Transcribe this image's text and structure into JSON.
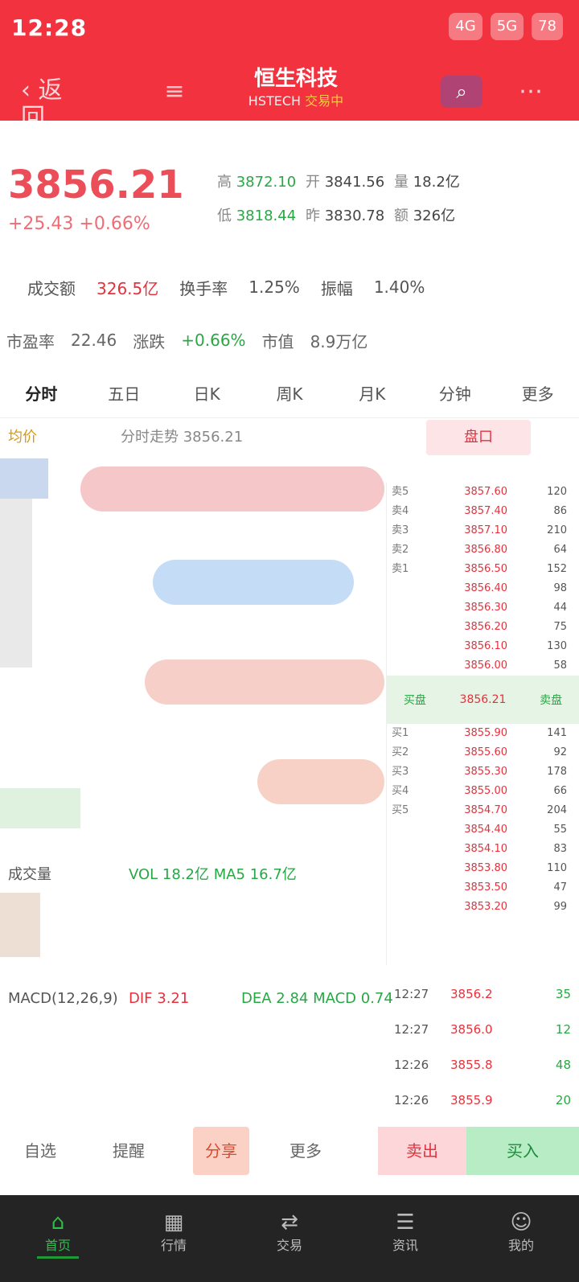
{
  "status_bar": {
    "time": "12:28",
    "indicators": [
      "4G",
      "5G",
      "78"
    ]
  },
  "header": {
    "back_label": "‹ 返回",
    "stock_name": "恒生科技",
    "stock_code": "HSTECH",
    "stock_status": "交易中",
    "menu_icon": "menu-icon",
    "search_icon": "search-icon",
    "more_icon": "more-icon"
  },
  "quote": {
    "price": "3856.21",
    "change": "+25.43 +0.66%",
    "rows": [
      [
        {
          "label": "高",
          "value": "3872.10",
          "tone": "green"
        },
        {
          "label": "开",
          "value": "3841.56",
          "tone": "dark"
        },
        {
          "label": "量",
          "value": "18.2亿",
          "tone": "dark"
        }
      ],
      [
        {
          "label": "低",
          "value": "3818.44",
          "tone": "green"
        },
        {
          "label": "昨",
          "value": "3830.78",
          "tone": "dark"
        },
        {
          "label": "额",
          "value": "326亿",
          "tone": "dark"
        }
      ]
    ]
  },
  "info_row1": [
    "成交额",
    "326.5亿",
    "换手率",
    "1.25%",
    "振幅",
    "1.40%"
  ],
  "info_row2": [
    "市盈率",
    "22.46",
    "涨跌",
    "+0.66%",
    "市值",
    "8.9万亿"
  ],
  "tabs": [
    "分时",
    "五日",
    "日K",
    "周K",
    "月K",
    "分钟",
    "更多"
  ],
  "chart_header": {
    "left": "均价",
    "mid": "分时走势 3856.21",
    "right": "盘口"
  },
  "orderbook": {
    "asks": [
      {
        "label": "卖5",
        "price": "3857.60",
        "vol": "120"
      },
      {
        "label": "卖4",
        "price": "3857.40",
        "vol": "86"
      },
      {
        "label": "卖3",
        "price": "3857.10",
        "vol": "210"
      },
      {
        "label": "卖2",
        "price": "3856.80",
        "vol": "64"
      },
      {
        "label": "卖1",
        "price": "3856.50",
        "vol": "152"
      },
      {
        "label": "",
        "price": "3856.40",
        "vol": "98"
      },
      {
        "label": "",
        "price": "3856.30",
        "vol": "44"
      },
      {
        "label": "",
        "price": "3856.20",
        "vol": "75"
      },
      {
        "label": "",
        "price": "3856.10",
        "vol": "130"
      },
      {
        "label": "",
        "price": "3856.00",
        "vol": "58"
      }
    ],
    "sep_left": "买盘",
    "sep_mid": "3856.21",
    "sep_right": "卖盘",
    "bids": [
      {
        "label": "买1",
        "price": "3855.90",
        "vol": "141"
      },
      {
        "label": "买2",
        "price": "3855.60",
        "vol": "92"
      },
      {
        "label": "买3",
        "price": "3855.30",
        "vol": "178"
      },
      {
        "label": "买4",
        "price": "3855.00",
        "vol": "66"
      },
      {
        "label": "买5",
        "price": "3854.70",
        "vol": "204"
      },
      {
        "label": "",
        "price": "3854.40",
        "vol": "55"
      },
      {
        "label": "",
        "price": "3854.10",
        "vol": "83"
      },
      {
        "label": "",
        "price": "3853.80",
        "vol": "110"
      },
      {
        "label": "",
        "price": "3853.50",
        "vol": "47"
      },
      {
        "label": "",
        "price": "3853.20",
        "vol": "99"
      }
    ]
  },
  "volume_header": {
    "left": "成交量",
    "mid": "VOL 18.2亿  MA5 16.7亿"
  },
  "macd_header": {
    "a": "MACD(12,26,9)",
    "b": "DIF 3.21",
    "c": "DEA 2.84  MACD 0.74"
  },
  "ticks": [
    {
      "time": "12:27",
      "price": "3856.2",
      "vol": "35"
    },
    {
      "time": "12:27",
      "price": "3856.0",
      "vol": "12"
    },
    {
      "time": "12:26",
      "price": "3855.8",
      "vol": "48"
    },
    {
      "time": "12:26",
      "price": "3855.9",
      "vol": "20"
    }
  ],
  "action_bar": {
    "a": "自选",
    "b": "提醒",
    "c": "分享",
    "d": "更多",
    "sell": "卖出",
    "buy": "买入"
  },
  "bottom_nav": [
    {
      "icon": "home-icon",
      "glyph": "⌂",
      "label": "首页",
      "active": true
    },
    {
      "icon": "market-icon",
      "glyph": "▦",
      "label": "行情",
      "active": false
    },
    {
      "icon": "trade-icon",
      "glyph": "⇄",
      "label": "交易",
      "active": false
    },
    {
      "icon": "news-icon",
      "glyph": "☰",
      "label": "资讯",
      "active": false
    },
    {
      "icon": "profile-icon",
      "glyph": "☺",
      "label": "我的",
      "active": false
    }
  ],
  "colors": {
    "brand_red": "#f2333f",
    "rise": "#e8303c",
    "fall": "#27a844",
    "nav_bg": "#242424"
  }
}
